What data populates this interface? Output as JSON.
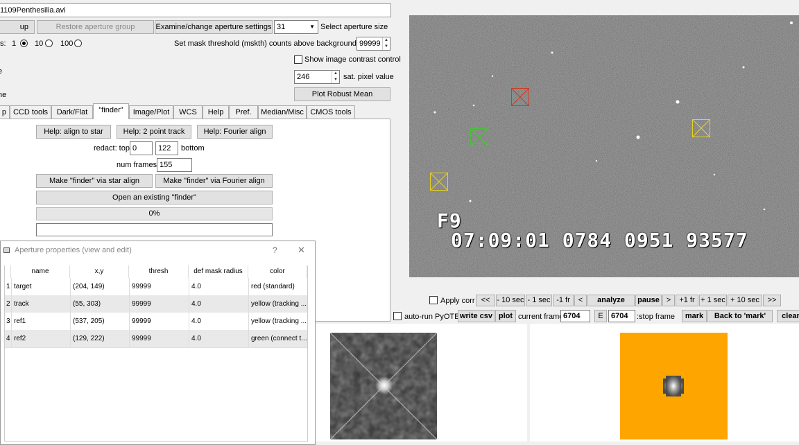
{
  "file_field": "1109Penthesilia.avi",
  "aperture_buttons": {
    "left_cut": "up",
    "restore": "Restore aperture group",
    "examine": "Examine/change aperture settings"
  },
  "aperture_size": {
    "value": "31",
    "label": "Select aperture size"
  },
  "radio_row": {
    "prefix": "s:",
    "opt1": "1",
    "opt2": "10",
    "opt3": "100"
  },
  "mask_threshold": {
    "label": "Set mask threshold (mskth) counts above background (bkavg)",
    "value": "99999"
  },
  "left_fragments": {
    "e": "e",
    "ne": "ne"
  },
  "contrast": {
    "label": "Show image contrast control"
  },
  "sat_pixel": {
    "value": "246",
    "label": "sat. pixel value"
  },
  "robust_mean_button": "Plot Robust Mean",
  "tabs": [
    "p",
    "CCD tools",
    "Dark/Flat",
    "\"finder\"",
    "Image/Plot",
    "WCS",
    "Help",
    "Pref.",
    "Median/Misc",
    "CMOS tools"
  ],
  "finder": {
    "help_align": "Help: align to star",
    "help_2pt": "Help: 2 point track",
    "help_fourier": "Help: Fourier align",
    "redact_label": "redact: top",
    "redact_top": "0",
    "redact_bottom": "122",
    "bottom_label": "bottom",
    "num_frames_label": "num frames:",
    "num_frames": "155",
    "make_star": "Make \"finder\" via star align",
    "make_fourier": "Make \"finder\" via Fourier align",
    "open_existing": "Open an existing  \"finder\"",
    "progress_label": "0%",
    "progress": 0
  },
  "dialog": {
    "title": "Aperture properties (view and edit)",
    "help_glyph": "?",
    "close_glyph": "✕",
    "columns": [
      "name",
      "x,y",
      "thresh",
      "def mask radius",
      "color"
    ],
    "rows": [
      {
        "idx": "1",
        "name": "target",
        "xy": "(204, 149)",
        "thresh": "99999",
        "radius": "4.0",
        "color": "red (standard)"
      },
      {
        "idx": "2",
        "name": "track",
        "xy": "(55, 303)",
        "thresh": "99999",
        "radius": "4.0",
        "color": "yellow (tracking ..."
      },
      {
        "idx": "3",
        "name": "ref1",
        "xy": "(537, 205)",
        "thresh": "99999",
        "radius": "4.0",
        "color": "yellow (tracking ..."
      },
      {
        "idx": "4",
        "name": "ref2",
        "xy": "(129, 222)",
        "thresh": "99999",
        "radius": "4.0",
        "color": "green (connect t..."
      }
    ]
  },
  "video": {
    "overlay_line1": "F9",
    "overlay_line2": "07:09:01 0784 0951 93577",
    "aperture_colors": {
      "red": "#d23a1e",
      "green": "#4bbf3a",
      "yellow": "#e6d21e"
    }
  },
  "transport": {
    "apply_corr": "Apply corr",
    "b_first": "<<",
    "b_m10": "- 10 sec",
    "b_m1": "- 1 sec",
    "b_m1fr": "-1 fr",
    "b_prev": "<",
    "b_analyze": "analyze",
    "b_pause": "pause",
    "b_next": ">",
    "b_p1fr": "+1 fr",
    "b_p1": "+ 1 sec",
    "b_p10": "+ 10 sec",
    "b_last": ">>"
  },
  "frame_row": {
    "auto_run": "auto-run PyOTE",
    "write_csv": "write csv",
    "plot": "plot",
    "current_label": "current frame:",
    "current_value": "6704",
    "e_button": "E",
    "stop_value": "6704",
    "stop_label": ":stop frame",
    "mark": "mark",
    "back": "Back to 'mark'",
    "clear": "clear"
  },
  "colors": {
    "orange_bg": "#ffa500"
  }
}
